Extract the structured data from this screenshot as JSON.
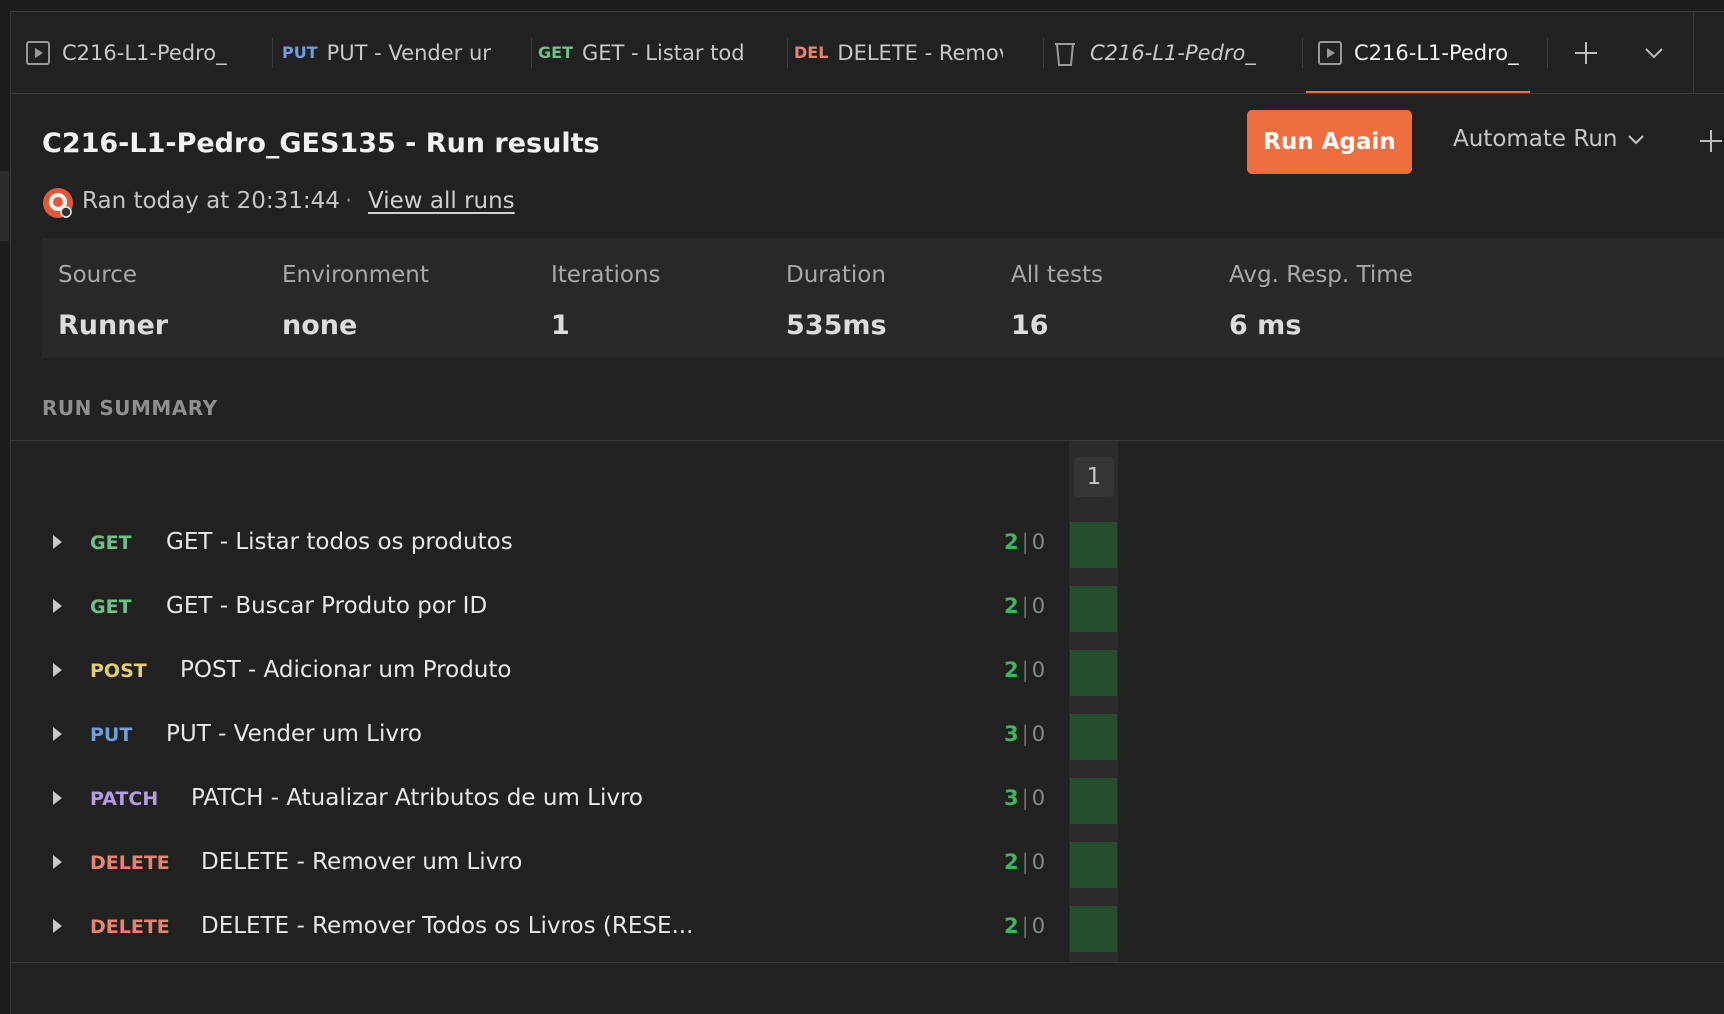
{
  "tabs": [
    {
      "method": "",
      "label": "C216-L1-Pedro_",
      "icon": "runner-icon",
      "active": false,
      "italic": false
    },
    {
      "method": "PUT",
      "label": "PUT - Vender ur",
      "icon": "",
      "active": false,
      "italic": false
    },
    {
      "method": "GET",
      "label": "GET - Listar tod",
      "icon": "",
      "active": false,
      "italic": false
    },
    {
      "method": "DEL",
      "label": "DELETE - Remov",
      "icon": "",
      "active": false,
      "italic": false
    },
    {
      "method": "",
      "label": "C216-L1-Pedro_",
      "icon": "trash-icon",
      "active": false,
      "italic": true
    },
    {
      "method": "",
      "label": "C216-L1-Pedro_",
      "icon": "runner-icon",
      "active": true,
      "italic": false
    }
  ],
  "header": {
    "title": "C216-L1-Pedro_GES135 - Run results",
    "ran_text": "Ran today at 20:31:44",
    "separator": "·",
    "view_all": "View all runs",
    "run_again": "Run Again",
    "automate": "Automate Run"
  },
  "stats": [
    {
      "key": "Source",
      "value": "Runner"
    },
    {
      "key": "Environment",
      "value": "none"
    },
    {
      "key": "Iterations",
      "value": "1"
    },
    {
      "key": "Duration",
      "value": "535ms"
    },
    {
      "key": "All tests",
      "value": "16"
    },
    {
      "key": "Avg. Resp. Time",
      "value": "6 ms"
    }
  ],
  "summary": {
    "heading": "RUN SUMMARY",
    "iteration_label": "1",
    "requests": [
      {
        "method": "GET",
        "name": "GET - Listar todos os produtos",
        "passed": "2",
        "failed": "0"
      },
      {
        "method": "GET",
        "name": "GET - Buscar Produto por ID",
        "passed": "2",
        "failed": "0"
      },
      {
        "method": "POST",
        "name": "POST - Adicionar um Produto",
        "passed": "2",
        "failed": "0"
      },
      {
        "method": "PUT",
        "name": "PUT - Vender um Livro",
        "passed": "3",
        "failed": "0"
      },
      {
        "method": "PATCH",
        "name": "PATCH - Atualizar Atributos de um Livro",
        "passed": "3",
        "failed": "0"
      },
      {
        "method": "DELETE",
        "name": "DELETE - Remover um Livro",
        "passed": "2",
        "failed": "0"
      },
      {
        "method": "DELETE",
        "name": "DELETE - Remover Todos os Livros (RESE...",
        "passed": "2",
        "failed": "0"
      }
    ]
  },
  "method_colors": {
    "GET": "#6cc28a",
    "PUT": "#6f9fe0",
    "POST": "#e6cf6a",
    "PATCH": "#b79be0",
    "DELETE": "#e8846f",
    "DEL": "#e8846f"
  },
  "colors": {
    "accent": "#ef6e3f",
    "pass": "#3fb55a",
    "pass_cell": "#244f2d"
  }
}
